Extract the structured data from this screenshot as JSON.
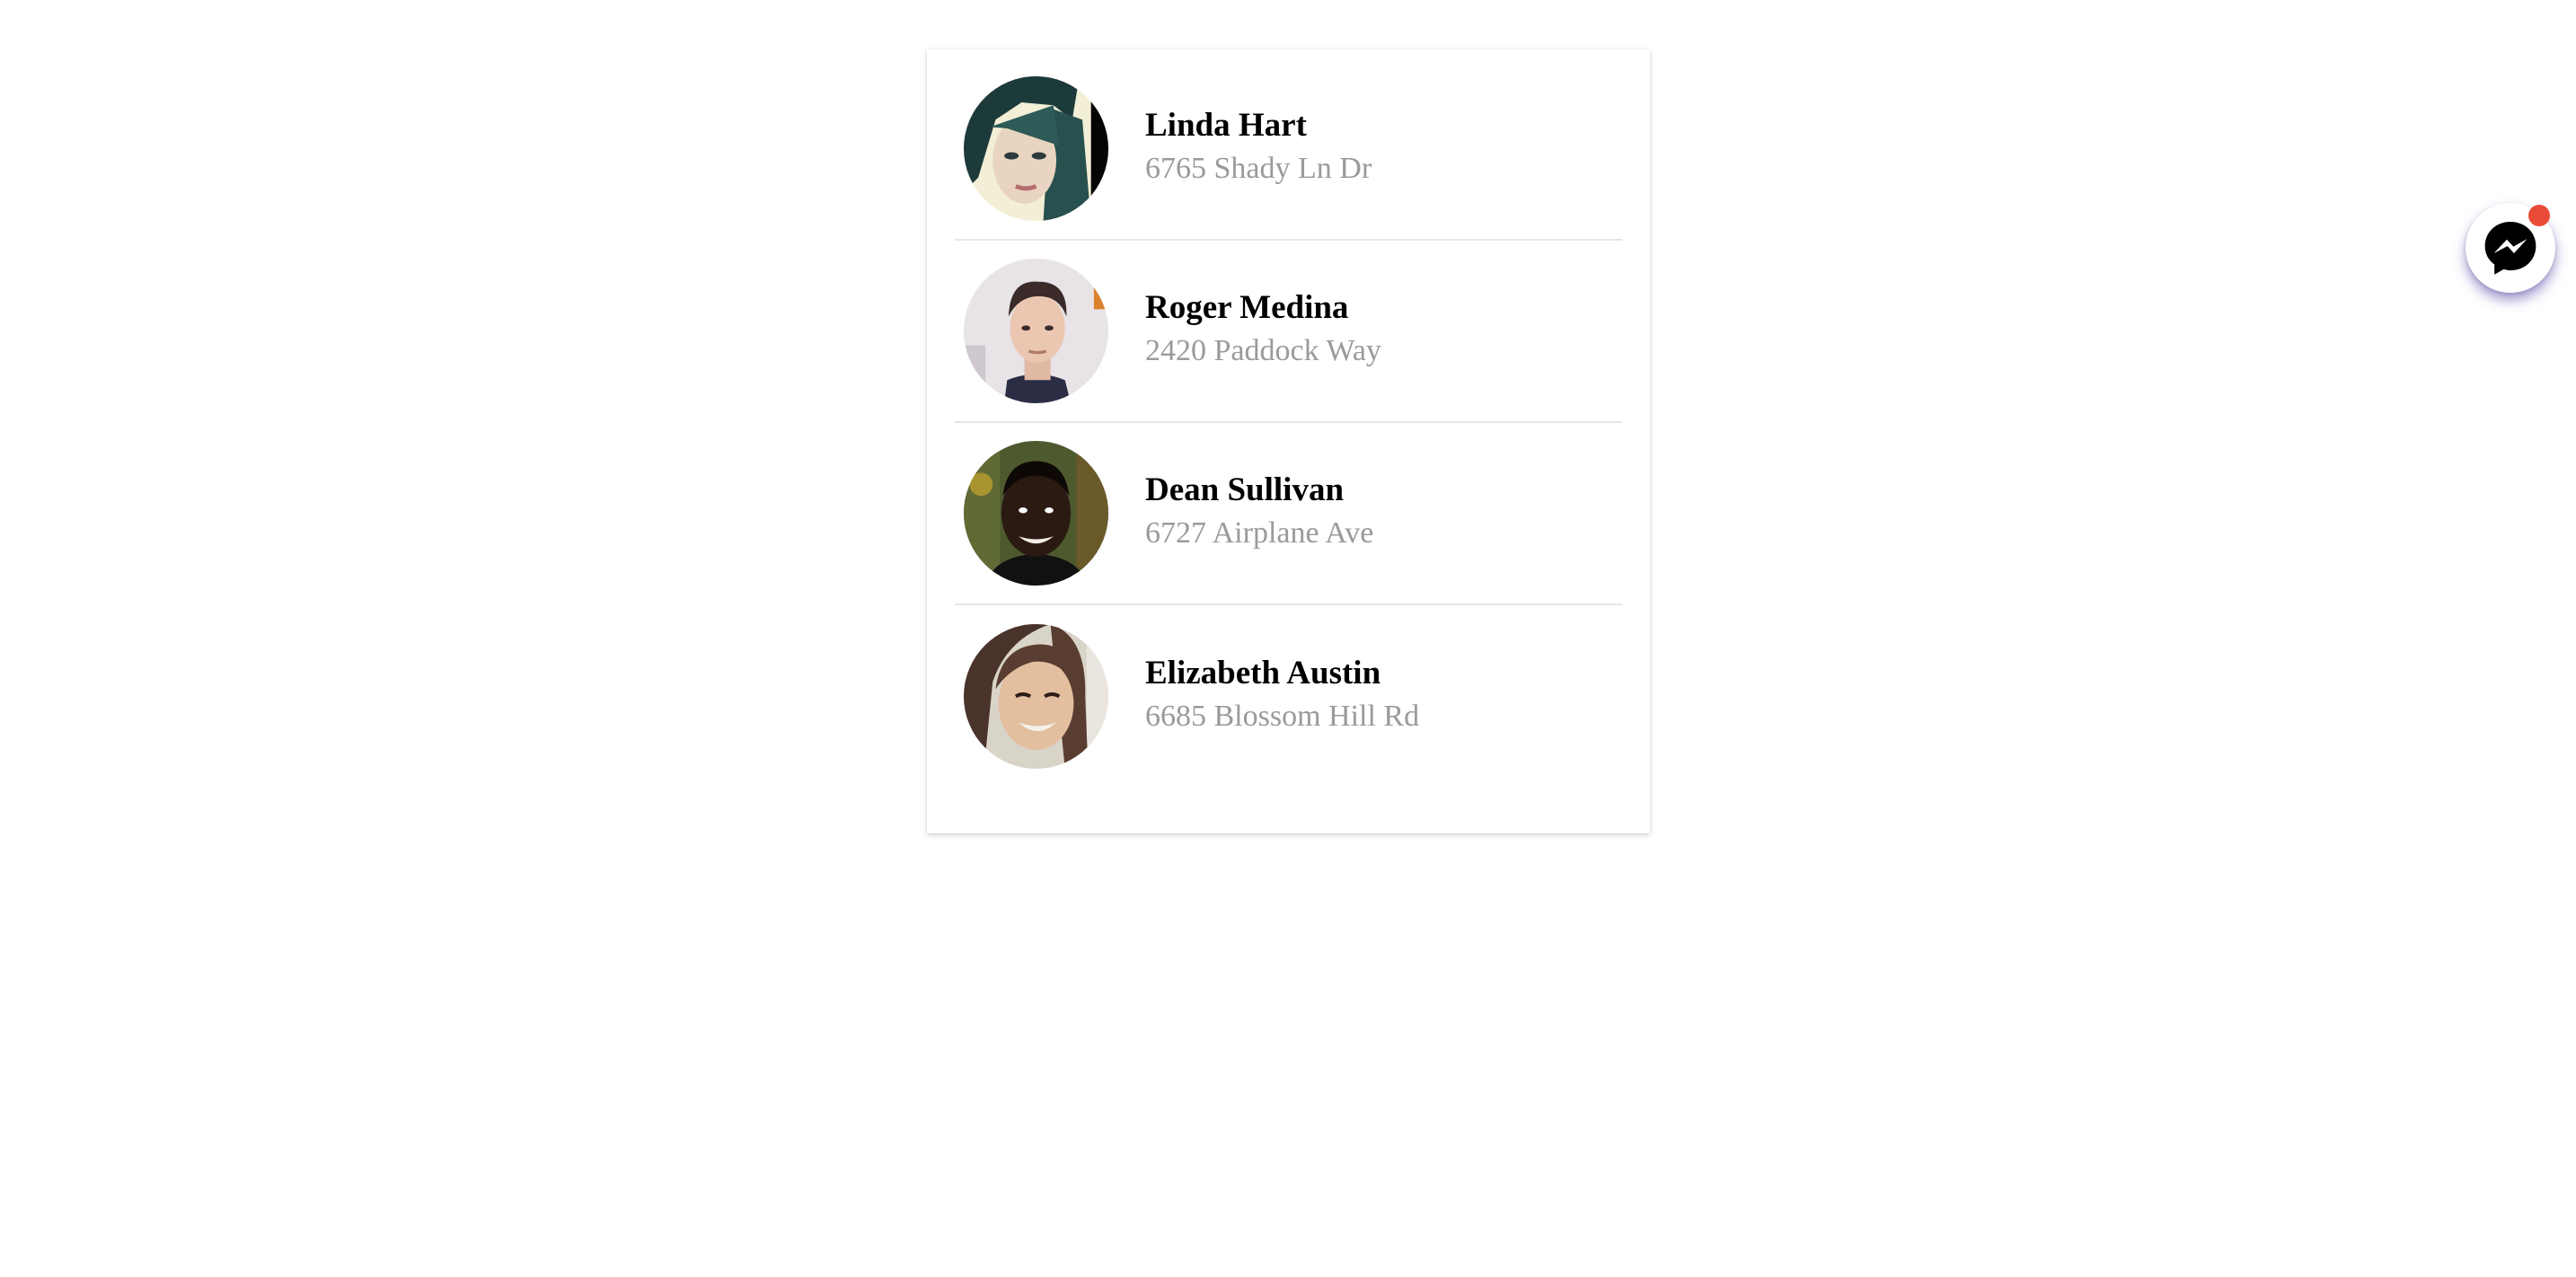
{
  "contacts": [
    {
      "name": "Linda Hart",
      "address": "6765 Shady Ln Dr",
      "avatar": "woman-dark-hair-photo"
    },
    {
      "name": "Roger Medina",
      "address": "2420 Paddock Way",
      "avatar": "man-short-hair-photo"
    },
    {
      "name": "Dean Sullivan",
      "address": "6727 Airplane Ave",
      "avatar": "man-smiling-photo"
    },
    {
      "name": "Elizabeth Austin",
      "address": "6685 Blossom Hill Rd",
      "avatar": "woman-smiling-photo"
    }
  ],
  "chat_button": {
    "icon": "messenger-icon",
    "has_notification": true,
    "notification_color": "#ea4b36"
  },
  "colors": {
    "name_text": "#000000",
    "address_text": "#9a9a9a",
    "divider": "#e6e6e6",
    "fab_shadow": "#5a46aa"
  }
}
